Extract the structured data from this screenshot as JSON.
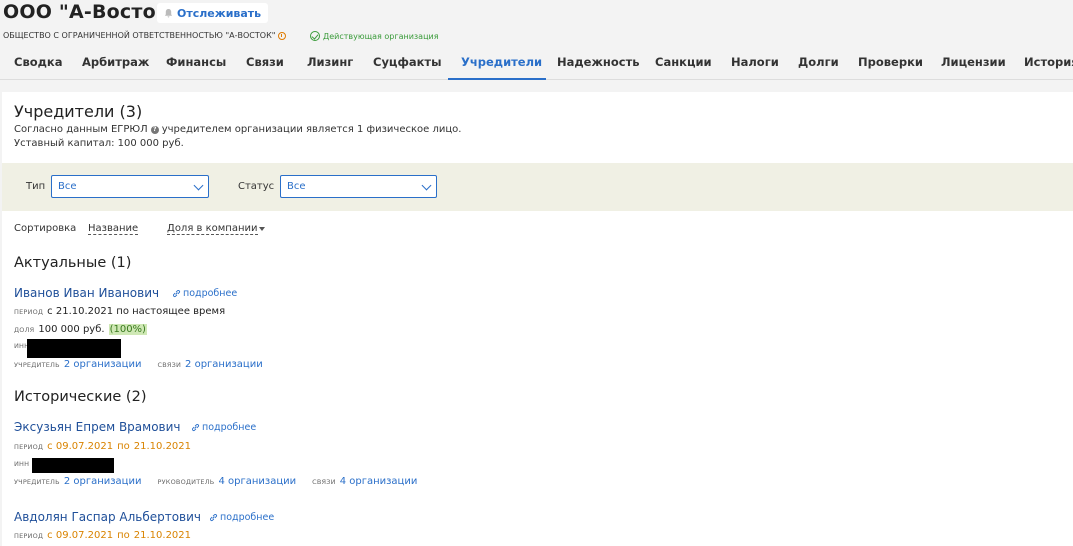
{
  "header": {
    "org_name": "ООО \"А-Восток\"",
    "track_label": "Отслеживать",
    "full_name": "ОБЩЕСТВО С ОГРАНИЧЕННОЙ ОТВЕТСТВЕННОСТЬЮ \"А-ВОСТОК\"",
    "status_text": "Действующая организация"
  },
  "tabs": [
    {
      "label": "Сводка"
    },
    {
      "label": "Арбитраж"
    },
    {
      "label": "Финансы"
    },
    {
      "label": "Связи"
    },
    {
      "label": "Лизинг"
    },
    {
      "label": "Суцфакты"
    },
    {
      "label": "Учредители",
      "active": true
    },
    {
      "label": "Надежность"
    },
    {
      "label": "Санкции"
    },
    {
      "label": "Налоги"
    },
    {
      "label": "Долги"
    },
    {
      "label": "Проверки"
    },
    {
      "label": "Лицензии"
    },
    {
      "label": "История"
    }
  ],
  "section": {
    "title": "Учредители (3)",
    "source_pre": "Согласно данным ЕГРЮЛ",
    "source_post": "учредителем организации является 1 физическое лицо.",
    "capital": "Уставный капитал: 100 000 руб."
  },
  "filters": {
    "type_label": "Тип",
    "type_value": "Все",
    "status_label": "Статус",
    "status_value": "Все"
  },
  "sort": {
    "label": "Сортировка",
    "by_name": "Название",
    "by_share": "Доля в компании"
  },
  "current": {
    "title": "Актуальные (1)",
    "items": [
      {
        "name": "Иванов Иван Иванович",
        "more": "подробнее",
        "period_label": "ПЕРИОД",
        "period": "с 21.10.2021 по настоящее время",
        "share_label": "ДОЛЯ",
        "share": "100 000 руб.",
        "share_pct": "(100%)",
        "inn_label": "ИНН",
        "founder_label": "УЧРЕДИТЕЛЬ",
        "founder_link": "2 организации",
        "links_label": "СВЯЗИ",
        "links_link": "2 организации"
      }
    ]
  },
  "historical": {
    "title": "Исторические (2)",
    "items": [
      {
        "name": "Эксузьян Епрем Врамович",
        "more": "подробнее",
        "period_label": "ПЕРИОД",
        "period_from": "с 09.07.2021",
        "period_by": "по",
        "period_to": "21.10.2021",
        "inn_label": "ИНН",
        "founder_label": "УЧРЕДИТЕЛЬ",
        "founder_link": "2 организации",
        "director_label": "РУКОВОДИТЕЛЬ",
        "director_link": "4 организации",
        "links_label": "СВЯЗИ",
        "links_link": "4 организации"
      },
      {
        "name": "Авдолян Гаспар Альбертович",
        "more": "подробнее",
        "period_label": "ПЕРИОД",
        "period_from": "с 09.07.2021",
        "period_by": "по",
        "period_to": "21.10.2021"
      }
    ]
  },
  "colors": {
    "accent": "#2a6fc9",
    "active_green": "#3a9b3a",
    "historic_orange": "#d98300"
  }
}
